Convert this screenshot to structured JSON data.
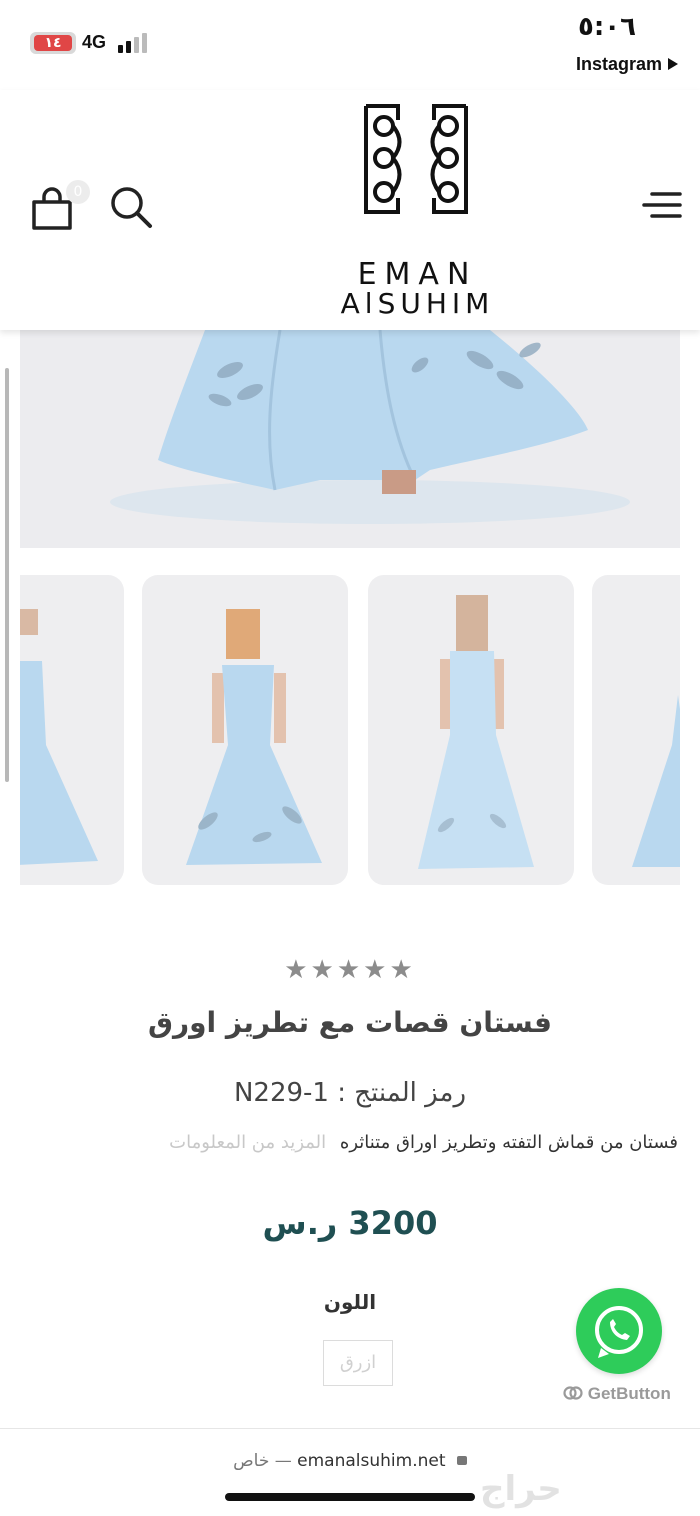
{
  "status_bar": {
    "battery": "١٤",
    "network": "4G",
    "time": "٥:٠٦",
    "back_app": "Instagram"
  },
  "header": {
    "cart_count": "0",
    "logo_line1": "EMAN",
    "logo_line2": "AlSUHIM",
    "icons": [
      "cart-icon",
      "search-icon",
      "menu-icon"
    ]
  },
  "product": {
    "rating_stars": "★★★★★",
    "rating_value": 0,
    "title": "فستان قصات مع تطريز اورق",
    "sku_label": "رمز المنتج :",
    "sku_value": "N229-1",
    "description": "فستان من قماش التفته وتطريز اوراق متناثره",
    "more_info": "المزيد من المعلومات",
    "price": "3200 ر.س",
    "color_label": "اللون",
    "color_option": "ازرق"
  },
  "floating": {
    "getbutton": "GetButton"
  },
  "browser": {
    "private_label": "خاص —",
    "url": "emanalsuhim.net",
    "watermark": "حراج"
  },
  "colors": {
    "price": "#1f4f52",
    "whatsapp": "#2ecc5a",
    "dress": "#b9d8ef",
    "stars": "#8c8c8c"
  }
}
